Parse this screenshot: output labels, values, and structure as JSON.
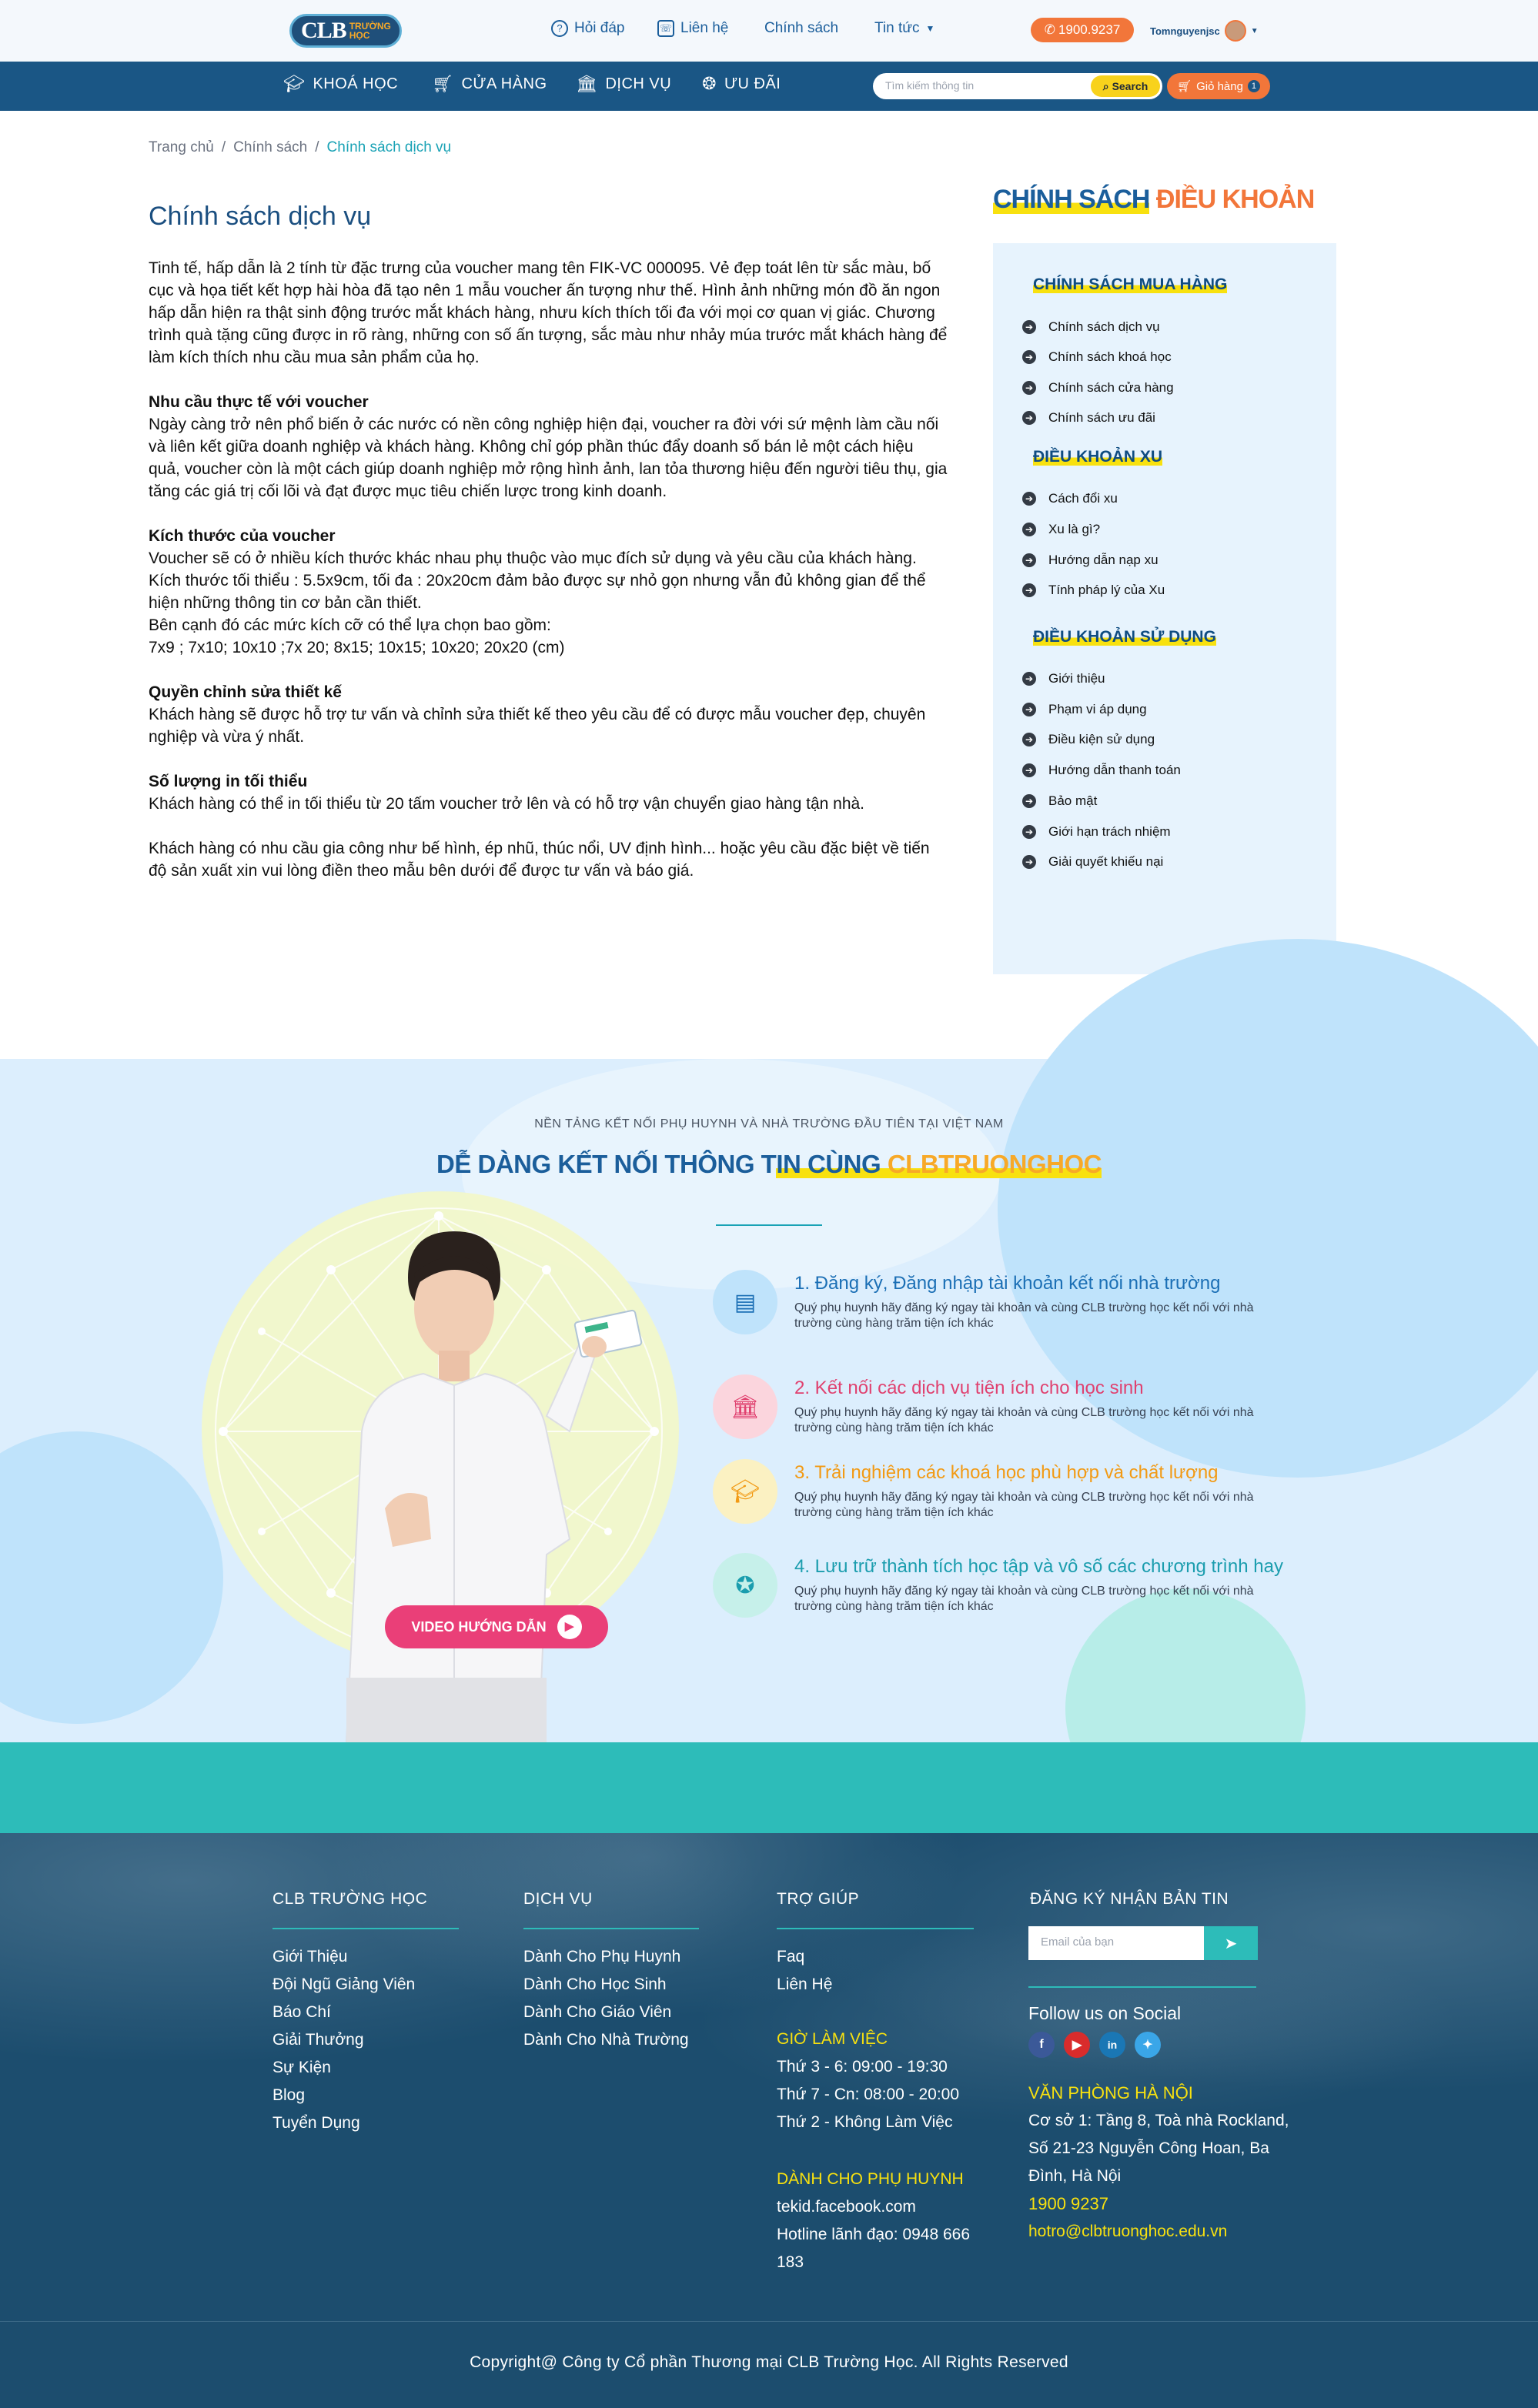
{
  "header": {
    "logo_main": "CLB",
    "logo_sub": "TRƯỜNG HỌC",
    "nav": [
      "Hỏi đáp",
      "Liên hệ",
      "Chính sách",
      "Tin tức"
    ],
    "phone": "1900.9237",
    "username": "Tomnguyenjsc"
  },
  "mainnav": {
    "items": [
      "KHOÁ HỌC",
      "CỬA HÀNG",
      "DỊCH VỤ",
      "ƯU ĐÃI"
    ],
    "search_placeholder": "Tìm kiếm thông tin",
    "search_label": "Search",
    "cart_label": "Giỏ hàng",
    "cart_count": "1"
  },
  "breadcrumb": [
    "Trang chủ",
    "Chính sách",
    "Chính sách dịch vụ"
  ],
  "article": {
    "title": "Chính sách dịch vụ",
    "intro": "Tinh tế, hấp dẫn là 2 tính từ đặc trưng của voucher mang tên FIK-VC 000095. Vẻ đẹp toát lên từ sắc màu, bố cục và họa tiết kết hợp hài hòa đã tạo nên 1 mẫu voucher ấn tượng như thế. Hình ảnh những món đồ ăn ngon hấp dẫn hiện ra thật sinh động trước mắt khách hàng, nhưu kích thích tối đa với mọi cơ quan vị giác. Chương trình quà tặng cũng được in rõ ràng, những con số ấn tượng, sắc màu như nhảy múa trước mắt khách hàng để làm kích thích nhu cầu mua sản phẩm của họ.",
    "h1": "Nhu cầu thực tế với voucher",
    "p1": "Ngày càng trở nên phổ biến ở các nước có nền công nghiệp hiện đại, voucher ra đời với sứ mệnh làm cầu nối và liên kết giữa doanh nghiệp và khách hàng. Không chỉ góp phần thúc đẩy doanh số bán lẻ một cách hiệu quả, voucher còn là một cách giúp doanh nghiệp mở rộng hình ảnh, lan tỏa thương hiệu đến người tiêu thụ, gia tăng các giá trị cối lõi và đạt được mục tiêu chiến lược trong kinh doanh.",
    "h2": "Kích thước của voucher",
    "p2a": "Voucher sẽ có ở nhiều kích thước khác nhau phụ thuộc vào mục đích sử dụng và yêu cầu của khách hàng.",
    "p2b": "Kích thước tối thiểu : 5.5x9cm,  tối đa : 20x20cm đảm bảo được sự nhỏ gọn nhưng vẫn đủ không gian để thể hiện những thông tin cơ bản cần thiết.",
    "p2c": "Bên cạnh đó các mức kích cỡ có thể lựa chọn bao gồm:",
    "p2d": "7x9 ; 7x10; 10x10 ;7x 20; 8x15; 10x15; 10x20; 20x20 (cm)",
    "h3": "Quyền chỉnh sửa thiết kế",
    "p3": "Khách hàng sẽ được hỗ trợ tư vấn và chỉnh sửa thiết kế theo yêu cầu để có được mẫu voucher đẹp, chuyên nghiệp và vừa ý nhất.",
    "h4": "Số lượng in tối thiểu",
    "p4": "Khách hàng có thể in tối thiểu từ 20 tấm voucher trở lên và có hỗ trợ vận chuyển giao hàng tận nhà.",
    "p5": "Khách hàng có nhu cầu gia công như bế hình, ép nhũ, thúc nổi, UV định hình... hoặc yêu cầu đặc biệt về tiến độ sản xuất xin vui lòng điền theo mẫu bên dưới để được tư vấn và báo giá."
  },
  "sidebar": {
    "title_a": "CHÍNH SÁCH",
    "title_b": "ĐIỀU KHOẢN",
    "groups": [
      {
        "heading": "CHÍNH SÁCH MUA HÀNG",
        "items": [
          "Chính sách dịch vụ",
          "Chính sách khoá học",
          "Chính sách cửa hàng",
          "Chính sách ưu đãi"
        ]
      },
      {
        "heading": "ĐIỀU KHOẢN XU",
        "items": [
          "Cách đổi xu",
          "Xu là gì?",
          "Hướng dẫn nạp xu",
          "Tính pháp lý của Xu"
        ]
      },
      {
        "heading": "ĐIỀU KHOẢN SỬ DỤNG",
        "items": [
          "Giới thiệu",
          "Phạm vi áp dụng",
          "Điều kiện sử dụng",
          "Hướng dẫn thanh toán",
          "Bảo mật",
          "Giới hạn trách nhiệm",
          "Giải quyết khiếu nại"
        ]
      }
    ]
  },
  "promo": {
    "subtitle": "NỀN TẢNG KẾT NỐI PHỤ HUYNH VÀ NHÀ TRƯỜNG ĐẦU TIÊN TẠI VIỆT NAM",
    "title_a": "DỄ DÀNG KẾT NỐI THÔNG T",
    "title_b": "IN CÙNG ",
    "title_c": "CLBTRUONGHOC",
    "video_label": "VIDEO HƯỚNG DẪN",
    "features": [
      {
        "title": "1. Đăng ký, Đăng nhập tài khoản kết nối nhà trường",
        "desc": "Quý phụ huynh hãy đăng ký ngay tài khoản và cùng CLB trường học kết nối với nhà trường cùng hàng trăm tiện ích khác",
        "color": "#1b6fb5",
        "bg": "#bfe3fb",
        "icon": "register-icon"
      },
      {
        "title": "2. Kết nối các dịch vụ tiện ích cho học sinh",
        "desc": "Quý phụ huynh hãy đăng ký ngay tài khoản và cùng CLB trường học kết nối với nhà trường cùng hàng trăm tiện ích khác",
        "color": "#e0416f",
        "bg": "#fbd5dd",
        "icon": "school-icon"
      },
      {
        "title": "3. Trải nghiệm các khoá học phù hợp và chất lượng",
        "desc": "Quý phụ huynh hãy đăng ký ngay tài khoản và cùng CLB trường học kết nối với nhà trường cùng hàng trăm tiện ích khác",
        "color": "#f29a14",
        "bg": "#fbf1c2",
        "icon": "graduation-cap-icon"
      },
      {
        "title": "4. Lưu trữ thành tích học tập và vô số các chương trình hay",
        "desc": "Quý phụ huynh hãy đăng ký ngay tài khoản và cùng CLB trường học kết nối với nhà trường cùng hàng trăm tiện ích khác",
        "color": "#1b9dae",
        "bg": "#c6f0ea",
        "icon": "award-icon"
      }
    ]
  },
  "footer": {
    "col1": {
      "heading": "CLB TRƯỜNG HỌC",
      "links": [
        "Giới Thiệu",
        "Đội Ngũ Giảng Viên",
        "Báo Chí",
        "Giải Thưởng",
        "Sự Kiện",
        "Blog",
        "Tuyển Dụng"
      ]
    },
    "col2": {
      "heading": "DỊCH VỤ",
      "links": [
        "Dành Cho Phụ Huynh",
        "Dành Cho Học Sinh",
        "Dành Cho Giáo Viên",
        "Dành Cho Nhà Trường"
      ]
    },
    "col3": {
      "heading": "TRỢ GIÚP",
      "links": [
        "Faq",
        "Liên Hệ"
      ],
      "hours_heading": "GIỜ LÀM VIỆC",
      "hours": [
        "Thứ 3 - 6: 09:00 - 19:30",
        "Thứ 7 - Cn: 08:00 - 20:00",
        "Thứ 2 - Không Làm Việc"
      ],
      "parents_heading": "DÀNH CHO PHỤ HUYNH",
      "parents": [
        "tekid.facebook.com",
        "Hotline lãnh đạo: 0948 666",
        "183"
      ]
    },
    "col4": {
      "heading": "ĐĂNG KÝ NHẬN BẢN TIN",
      "email_placeholder": "Email của bạn",
      "social_heading": "Follow us on Social",
      "office_heading": "VĂN PHÒNG HÀ NỘI",
      "address": [
        "Cơ sở 1: Tầng 8, Toà nhà Rockland,",
        "Số 21-23 Nguyễn Công Hoan, Ba",
        "Đình, Hà Nội"
      ],
      "phone": "1900 9237",
      "email": "hotro@clbtruonghoc.edu.vn"
    },
    "copyright": "Copyright@ Công ty Cổ phần Thương mại CLB Trường Học. All Rights Reserved"
  }
}
